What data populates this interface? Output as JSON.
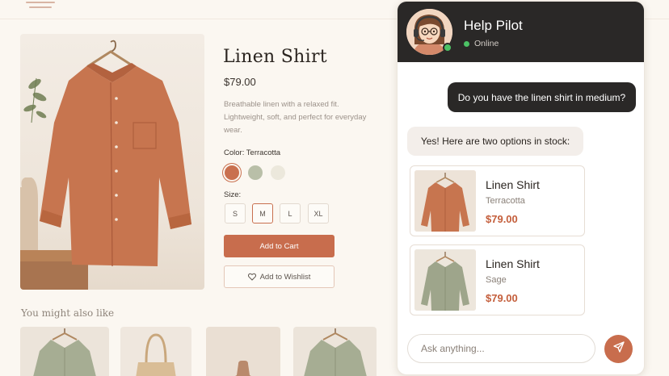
{
  "product": {
    "title": "Linen Shirt",
    "price": "$79.00",
    "description": "Breathable linen with a relaxed fit. Lightweight, soft, and perfect for everyday wear.",
    "color_label": "Color: Terracotta",
    "swatches": [
      "#c9704f",
      "#b9bfa8",
      "#ece8dc"
    ],
    "size_label": "Size:",
    "sizes": [
      "S",
      "M",
      "L",
      "XL"
    ],
    "selected_size": "M",
    "add_to_cart": "Add to Cart",
    "add_to_wishlist": "Add to Wishlist"
  },
  "related": {
    "title": "You might also like"
  },
  "chat": {
    "title": "Help Pilot",
    "status": "Online",
    "messages": [
      {
        "from": "user",
        "text": "Do you have the linen shirt in medium?"
      },
      {
        "from": "bot",
        "text": "Yes! Here are two options in stock:"
      }
    ],
    "products": [
      {
        "name": "Linen Shirt",
        "color": "Terracotta",
        "price": "$79.00"
      },
      {
        "name": "Linen Shirt",
        "color": "Sage",
        "price": "$79.00"
      }
    ],
    "input_placeholder": "Ask anything..."
  },
  "colors": {
    "accent": "#c86d4d",
    "header_bg": "#2a2827",
    "online": "#4cc265",
    "price": "#c45e3b"
  },
  "icons": [
    "menu-icon",
    "heart-icon",
    "send-icon"
  ]
}
